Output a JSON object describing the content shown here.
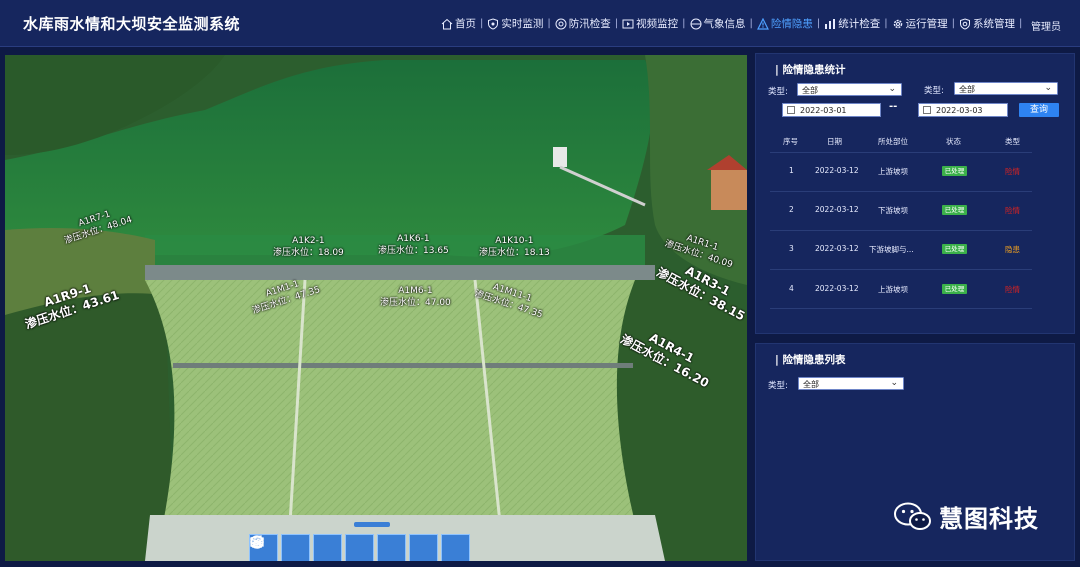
{
  "app": {
    "title": "水库雨水情和大坝安全监测系统",
    "user": "管理员"
  },
  "nav": {
    "items": [
      {
        "label": "首页",
        "icon": "home-icon"
      },
      {
        "label": "实时监测",
        "icon": "shield-icon"
      },
      {
        "label": "防汛检查",
        "icon": "search-circle-icon"
      },
      {
        "label": "视频监控",
        "icon": "video-icon"
      },
      {
        "label": "气象信息",
        "icon": "weather-icon"
      },
      {
        "label": "险情隐患",
        "icon": "warning-icon",
        "active": true
      },
      {
        "label": "统计检查",
        "icon": "bar-chart-icon"
      },
      {
        "label": "运行管理",
        "icon": "gear-icon"
      },
      {
        "label": "系统管理",
        "icon": "shield-gear-icon"
      }
    ],
    "separator": "|"
  },
  "map": {
    "pressure_label": "渗压水位：",
    "sensors": [
      {
        "id": "A1R7-1",
        "value": "48.04"
      },
      {
        "id": "A1K2-1",
        "value": "18.09"
      },
      {
        "id": "A1K6-1",
        "value": "13.65"
      },
      {
        "id": "A1K10-1",
        "value": "18.13"
      },
      {
        "id": "A1R1-1",
        "value": "40.09"
      },
      {
        "id": "A1R9-1",
        "value": "43.61"
      },
      {
        "id": "A1M1-1",
        "value": "47.35"
      },
      {
        "id": "A1M6-1",
        "value": "47.00"
      },
      {
        "id": "A1M11-1",
        "value": "47.35"
      },
      {
        "id": "A1R3-1",
        "value": "38.15"
      },
      {
        "id": "A1R4-1",
        "value": "16.20"
      }
    ],
    "toolbar": [
      "wave-icon",
      "layers-icon",
      "water-icon",
      "chart-icon",
      "dam-icon",
      "monitor-icon",
      "music-icon"
    ]
  },
  "stats_panel": {
    "title": "| 险情隐患统计",
    "type_label_1": "类型:",
    "type_value_1": "全部",
    "type_label_2": "类型:",
    "type_value_2": "全部",
    "date_start": "2022-03-01",
    "date_end": "2022-03-03",
    "date_dash": "--",
    "query_label": "查询",
    "columns": [
      "序号",
      "日期",
      "所处部位",
      "状态",
      "类型"
    ],
    "rows": [
      {
        "no": "1",
        "date": "2022-03-12",
        "location": "上游坡坝",
        "status": "已处理",
        "type": "险情",
        "type_color": "red"
      },
      {
        "no": "2",
        "date": "2022-03-12",
        "location": "下游坡坝",
        "status": "已处理",
        "type": "险情",
        "type_color": "red"
      },
      {
        "no": "3",
        "date": "2022-03-12",
        "location": "下游坡脚与...",
        "status": "已处理",
        "type": "隐患",
        "type_color": "orange"
      },
      {
        "no": "4",
        "date": "2022-03-12",
        "location": "上游坡坝",
        "status": "已处理",
        "type": "险情",
        "type_color": "red"
      }
    ]
  },
  "list_panel": {
    "title": "| 险情隐患列表",
    "type_label": "类型:",
    "type_value": "全部"
  },
  "watermark": {
    "text": "慧图科技",
    "icon": "wechat-icon"
  },
  "colors": {
    "accent": "#4fa0ff",
    "bg": "#0e1a45",
    "panel": "#16265e",
    "status_ok": "#3bb14a",
    "danger": "#e0231f",
    "hazard": "#f0a020"
  }
}
